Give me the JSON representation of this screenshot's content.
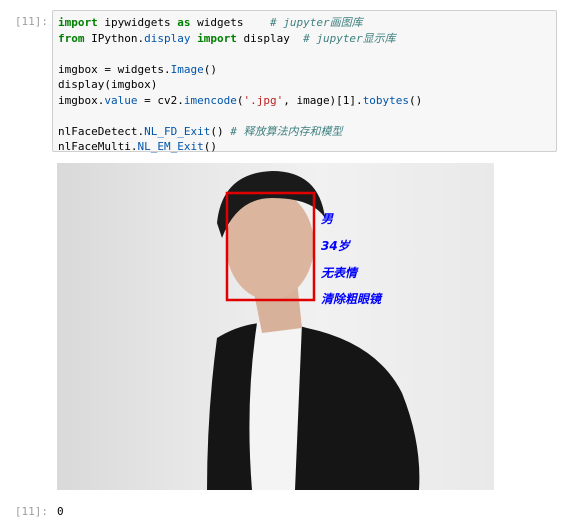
{
  "cell": {
    "input_prompt": "[11]:",
    "output_prompt": "[11]:",
    "output_value": "0",
    "code_lines": [
      [
        {
          "t": "import",
          "c": "kw"
        },
        {
          "t": " ipywidgets ",
          "c": ""
        },
        {
          "t": "as",
          "c": "kw"
        },
        {
          "t": " widgets    ",
          "c": ""
        },
        {
          "t": "# jupyter画图库",
          "c": "cm"
        }
      ],
      [
        {
          "t": "from",
          "c": "kw"
        },
        {
          "t": " IPython.",
          "c": ""
        },
        {
          "t": "display",
          "c": "attr"
        },
        {
          "t": " ",
          "c": ""
        },
        {
          "t": "import",
          "c": "kw"
        },
        {
          "t": " display  ",
          "c": ""
        },
        {
          "t": "# jupyter显示库",
          "c": "cm"
        }
      ],
      [],
      [
        {
          "t": "imgbox = widgets.",
          "c": ""
        },
        {
          "t": "Image",
          "c": "attr"
        },
        {
          "t": "()",
          "c": ""
        }
      ],
      [
        {
          "t": "display(imgbox)",
          "c": ""
        }
      ],
      [
        {
          "t": "imgbox.",
          "c": ""
        },
        {
          "t": "value",
          "c": "attr"
        },
        {
          "t": " = cv2.",
          "c": ""
        },
        {
          "t": "imencode",
          "c": "attr"
        },
        {
          "t": "(",
          "c": ""
        },
        {
          "t": "'.jpg'",
          "c": "str"
        },
        {
          "t": ", image)[1].",
          "c": ""
        },
        {
          "t": "tobytes",
          "c": "attr"
        },
        {
          "t": "()",
          "c": ""
        }
      ],
      [],
      [
        {
          "t": "nlFaceDetect.",
          "c": ""
        },
        {
          "t": "NL_FD_Exit",
          "c": "attr"
        },
        {
          "t": "() ",
          "c": ""
        },
        {
          "t": "# 释放算法内存和模型",
          "c": "cm"
        }
      ],
      [
        {
          "t": "nlFaceMulti.",
          "c": ""
        },
        {
          "t": "NL_EM_Exit",
          "c": "attr"
        },
        {
          "t": "()",
          "c": ""
        }
      ]
    ]
  },
  "face_labels": [
    "男",
    "34岁",
    "无表情",
    "清除粗眼镜"
  ],
  "colors": {
    "box": "#e00000",
    "label": "#0000ff"
  }
}
